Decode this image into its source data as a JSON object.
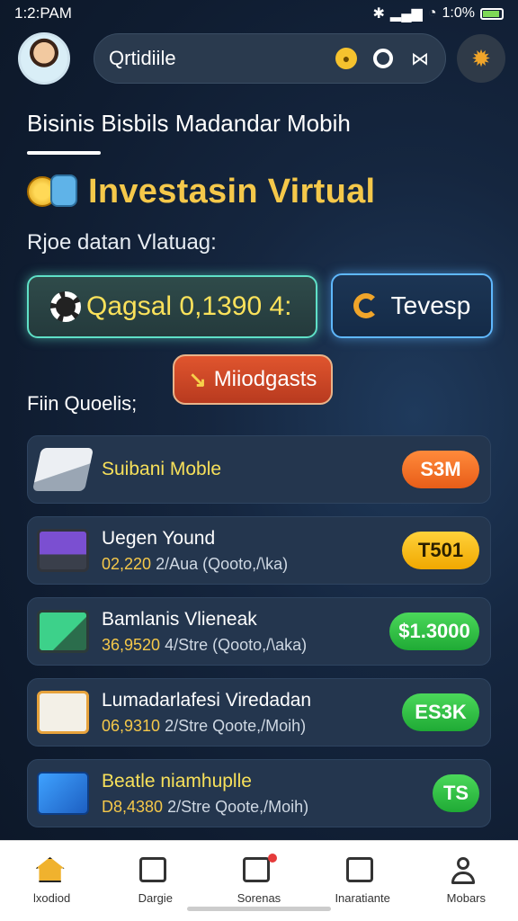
{
  "status_bar": {
    "time": "1:2:PAM",
    "battery_text": "1:0%"
  },
  "search": {
    "value": "Qrtidiile"
  },
  "page": {
    "title": "Bisinis Bisbils Madandar Mobih"
  },
  "section": {
    "heading": "Investasin Virtual",
    "subheading": "Rjoe datan Vlatuag:"
  },
  "balance_button": {
    "label": "Qagsal 0,1390 4:"
  },
  "topup_button": {
    "label": "Tevesp"
  },
  "method_button": {
    "label": "Miiodgasts"
  },
  "list_heading": "Fiin Quoelis;",
  "items": [
    {
      "name": "Suibani Moble",
      "meta": "",
      "meta_suffix": "",
      "tag": "S3M"
    },
    {
      "name": "Uegen Yound",
      "price": "02,220",
      "meta_suffix": "2/Aua (Qooto,/\\ka)",
      "tag": "T501"
    },
    {
      "name": "Bamlanis Vlieneak",
      "price": "36,9520",
      "meta_suffix": "4/Stre (Qooto,/\\aka)",
      "tag": "$1.3000"
    },
    {
      "name": "Lumadarlafesi Viredadan",
      "price": "06,9310",
      "meta_suffix": "2/Stre Qoote,/Moih)",
      "tag": "ES3K"
    },
    {
      "name": "Beatle niamhuplle",
      "price": "D8,4380",
      "meta_suffix": "2/Stre Qoote,/Moih)",
      "tag": "TS"
    }
  ],
  "nav": [
    {
      "label": "lxodiod",
      "icon": "home-icon"
    },
    {
      "label": "Dargie",
      "icon": "chart-icon"
    },
    {
      "label": "Sorenas",
      "icon": "edit-icon"
    },
    {
      "label": "Inaratiante",
      "icon": "mail-icon"
    },
    {
      "label": "Mobars",
      "icon": "user-icon"
    }
  ],
  "colors": {
    "accent_gold": "#f5c84a",
    "teal_border": "#5fe0c7",
    "blue_border": "#5fb8ff",
    "orange_button": "#e0552e"
  }
}
